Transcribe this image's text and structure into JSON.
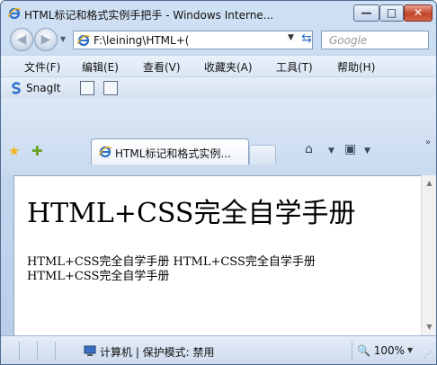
{
  "window": {
    "title": "HTML标记和格式实例手把手 - Windows Interne...",
    "buttons": {
      "minimize": "—",
      "maximize": "□",
      "close": "✕"
    }
  },
  "address": {
    "url": "F:\\leining\\HTML+(",
    "search_placeholder": "Google"
  },
  "menu": {
    "items": [
      "文件(F)",
      "编辑(E)",
      "查看(V)",
      "收藏夹(A)",
      "工具(T)",
      "帮助(H)"
    ]
  },
  "snagit": {
    "label": "SnagIt"
  },
  "tab": {
    "title": "HTML标记和格式实例..."
  },
  "page": {
    "heading": "HTML+CSS完全自学手册",
    "body_line1": "HTML+CSS完全自学手册 HTML+CSS完全自学手册",
    "body_line2": "HTML+CSS完全自学手册"
  },
  "status": {
    "zone": "计算机 | 保护模式: 禁用",
    "zoom": "100%"
  },
  "icons": {
    "back": "back-arrow-icon",
    "forward": "forward-arrow-icon",
    "ie": "ie-logo-icon",
    "refresh": "refresh-icon",
    "stop": "stop-icon",
    "favorites": "favorites-star-icon",
    "add_favorite": "add-favorite-icon",
    "home": "home-icon",
    "feeds": "feeds-icon",
    "computer": "computer-icon",
    "zoom": "zoom-magnifier-icon"
  },
  "colors": {
    "chrome": "#cfe0f4",
    "close_button": "#c2452a",
    "ie_blue": "#2e6fc7"
  }
}
